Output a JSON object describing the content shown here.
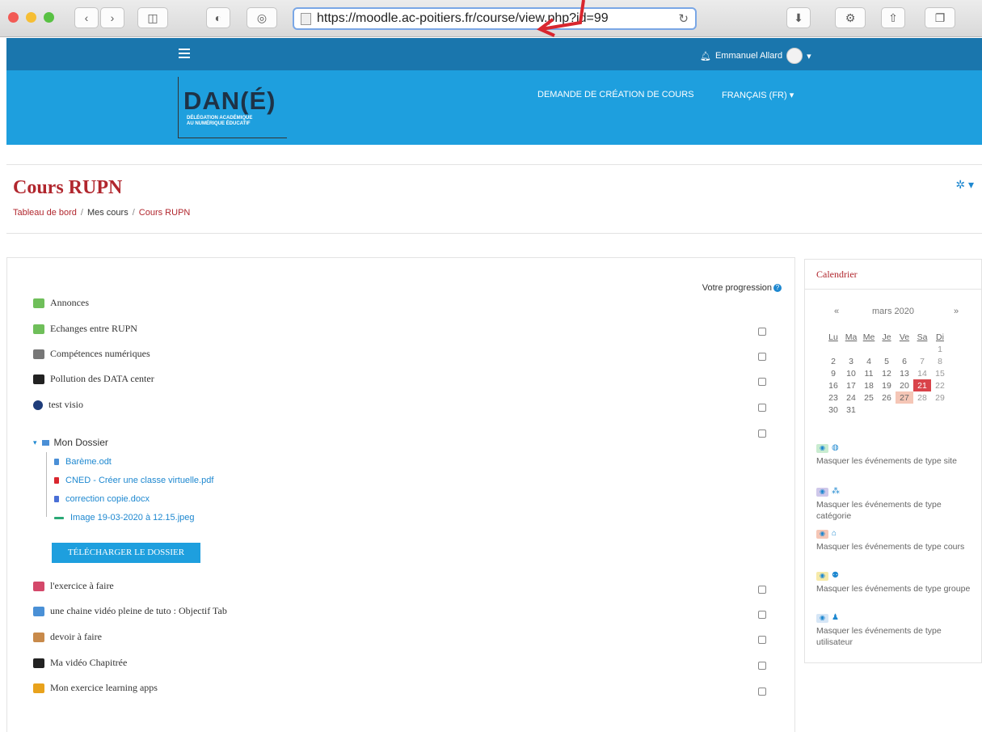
{
  "browser": {
    "url": "https://moodle.ac-poitiers.fr/course/view.php?id=99"
  },
  "navbar": {
    "user_name": "Emmanuel Allard"
  },
  "header": {
    "logo_text": "DAN(É)",
    "logo_sub1": "DÉLÉGATION ACADÉMIQUE",
    "logo_sub2": "AU NUMÉRIQUE ÉDUCATIF",
    "nav_request": "DEMANDE DE CRÉATION DE COURS",
    "nav_lang": "FRANÇAIS (FR)"
  },
  "page": {
    "title": "Cours RUPN",
    "breadcrumb": [
      "Tableau de bord",
      "Mes cours",
      "Cours RUPN"
    ]
  },
  "course": {
    "progress_label": "Votre progression",
    "activities_top": [
      {
        "label": "Annonces",
        "icon": "forum-icon",
        "color": "#6fbf5a"
      },
      {
        "label": "Echanges entre RUPN",
        "icon": "forum-icon",
        "color": "#6fbf5a"
      },
      {
        "label": "Compétences numériques",
        "icon": "grid-icon",
        "color": "#777777"
      },
      {
        "label": "Pollution des DATA center",
        "icon": "h5p-icon",
        "color": "#222222"
      },
      {
        "label": "test visio",
        "icon": "bbb-icon",
        "color": "#1e3c7a"
      }
    ],
    "folder": {
      "label": "Mon Dossier",
      "files": [
        {
          "label": "Barème.odt",
          "color": "#4a8fd6"
        },
        {
          "label": "CNED - Créer une classe virtuelle.pdf",
          "color": "#d9262e"
        },
        {
          "label": "correction copie.docx",
          "color": "#4a6fd6"
        },
        {
          "label": "Image 19-03-2020 à 12.15.jpeg",
          "color": "#2aa876"
        }
      ],
      "download_label": "TÉLÉCHARGER LE DOSSIER"
    },
    "activities_bottom": [
      {
        "label": "l'exercice à faire",
        "icon": "quiz-icon",
        "color": "#d4486a"
      },
      {
        "label": "une chaine vidéo pleine de tuto : Objectif Tab",
        "icon": "url-icon",
        "color": "#4a90d6"
      },
      {
        "label": "devoir à faire",
        "icon": "assign-icon",
        "color": "#c88a4a"
      },
      {
        "label": "Ma vidéo Chapitrée",
        "icon": "h5p-icon",
        "color": "#222222"
      },
      {
        "label": "Mon exercice learning apps",
        "icon": "lti-icon",
        "color": "#e8a21c"
      }
    ]
  },
  "calendar": {
    "title": "Calendrier",
    "prev": "«",
    "next": "»",
    "month": "mars 2020",
    "days": [
      "Lu",
      "Ma",
      "Me",
      "Je",
      "Ve",
      "Sa",
      "Di"
    ],
    "weeks": [
      [
        "",
        "",
        "",
        "",
        "",
        "",
        "1"
      ],
      [
        "2",
        "3",
        "4",
        "5",
        "6",
        "7",
        "8"
      ],
      [
        "9",
        "10",
        "11",
        "12",
        "13",
        "14",
        "15"
      ],
      [
        "16",
        "17",
        "18",
        "19",
        "20",
        "21",
        "22"
      ],
      [
        "23",
        "24",
        "25",
        "26",
        "27",
        "28",
        "29"
      ],
      [
        "30",
        "31",
        "",
        "",
        "",
        "",
        ""
      ]
    ],
    "today": "21",
    "event_day": "27",
    "event_types": [
      {
        "label": "Masquer les événements de type site",
        "bg": "#c9ecd0"
      },
      {
        "label": "Masquer les événements de type catégorie",
        "bg": "#cfc8ea"
      },
      {
        "label": "Masquer les événements de type cours",
        "bg": "#f5c6b6"
      },
      {
        "label": "Masquer les événements de type groupe",
        "bg": "#f6eaa9"
      },
      {
        "label": "Masquer les événements de type utilisateur",
        "bg": "#d6e6f6"
      }
    ]
  }
}
